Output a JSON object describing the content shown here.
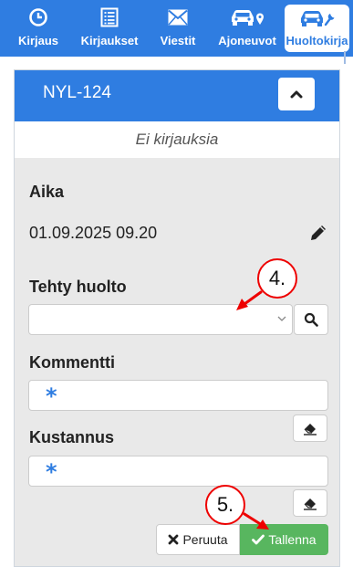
{
  "nav": {
    "tabs": [
      {
        "label": "Kirjaus",
        "icon": "clock-icon"
      },
      {
        "label": "Kirjaukset",
        "icon": "list-icon"
      },
      {
        "label": "Viestit",
        "icon": "envelope-icon"
      },
      {
        "label": "Ajoneuvot",
        "icon": "car-location-icon"
      },
      {
        "label": "Huoltokirja",
        "icon": "car-wrench-icon",
        "active": true
      }
    ]
  },
  "panel": {
    "title": "NYL-124",
    "empty_text": "Ei kirjauksia",
    "time_label": "Aika",
    "time_value": "01.09.2025 09.20",
    "service_label": "Tehty huolto",
    "service_value": "",
    "comment_label": "Kommentti",
    "comment_value": "",
    "cost_label": "Kustannus",
    "cost_value": "",
    "required_mark": "*",
    "cancel_label": "Peruuta",
    "save_label": "Tallenna"
  },
  "annotations": [
    "4.",
    "5."
  ],
  "colors": {
    "primary": "#2f7de1",
    "success": "#58b65f",
    "panel_bg": "#e9e9e9",
    "annotation": "#e00000"
  }
}
